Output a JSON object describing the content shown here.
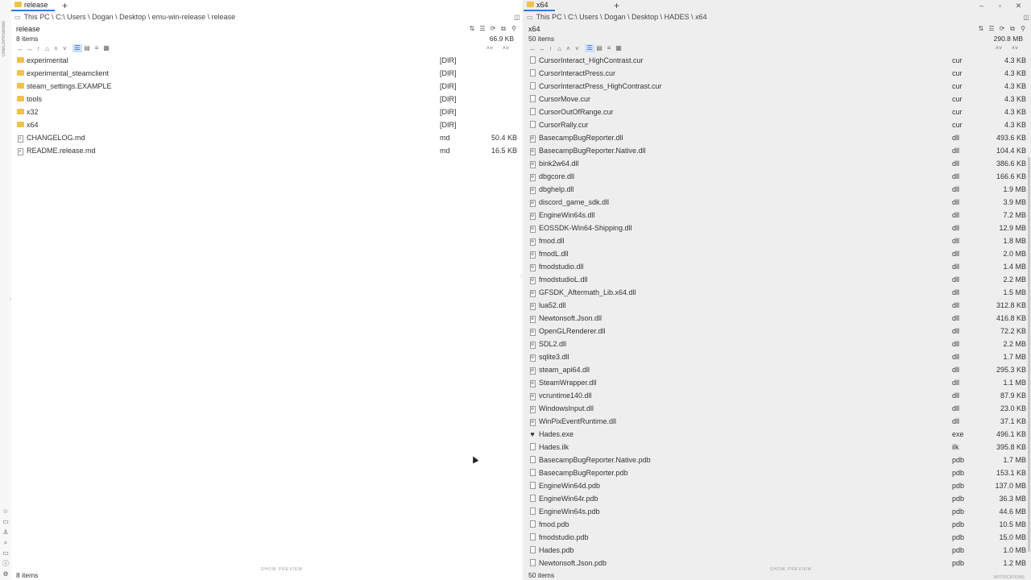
{
  "app": {
    "brand": "OneCommander"
  },
  "left": {
    "tab_label": "release",
    "new_tab": "+",
    "path": "This PC \\ C:\\ Users \\ Dogan \\ Desktop \\ emu-win-release \\ release",
    "folder_name": "release",
    "item_count": "8 items",
    "total_size": "66.9 KB",
    "status": "8 items",
    "preview_hint": "SHOW PREVIEW",
    "files": [
      {
        "name": "experimental",
        "ext": "[DIR]",
        "size": "",
        "kind": "folder"
      },
      {
        "name": "experimental_steamclient",
        "ext": "[DIR]",
        "size": "",
        "kind": "folder"
      },
      {
        "name": "steam_settings.EXAMPLE",
        "ext": "[DIR]",
        "size": "",
        "kind": "folder"
      },
      {
        "name": "tools",
        "ext": "[DIR]",
        "size": "",
        "kind": "folder"
      },
      {
        "name": "x32",
        "ext": "[DIR]",
        "size": "",
        "kind": "folder"
      },
      {
        "name": "x64",
        "ext": "[DIR]",
        "size": "",
        "kind": "folder"
      },
      {
        "name": "CHANGELOG.md",
        "ext": "md",
        "size": "50.4 KB",
        "kind": "md"
      },
      {
        "name": "README.release.md",
        "ext": "md",
        "size": "16.5 KB",
        "kind": "md"
      }
    ]
  },
  "right": {
    "tab_label": "x64",
    "new_tab": "+",
    "path": "This PC \\ C:\\ Users \\ Dogan \\ Desktop \\ HADES \\ x64",
    "folder_name": "x64",
    "item_count": "50 items",
    "total_size": "290.8 MB",
    "status": "50 items",
    "preview_hint": "SHOW PREVIEW",
    "notifications": "NOTIFICATIONS",
    "files": [
      {
        "name": "CursorInteract_HighContrast.cur",
        "ext": "cur",
        "size": "4.3 KB",
        "kind": "doc"
      },
      {
        "name": "CursorInteractPress.cur",
        "ext": "cur",
        "size": "4.3 KB",
        "kind": "doc"
      },
      {
        "name": "CursorInteractPress_HighContrast.cur",
        "ext": "cur",
        "size": "4.3 KB",
        "kind": "doc"
      },
      {
        "name": "CursorMove.cur",
        "ext": "cur",
        "size": "4.3 KB",
        "kind": "doc"
      },
      {
        "name": "CursorOutOfRange.cur",
        "ext": "cur",
        "size": "4.3 KB",
        "kind": "doc"
      },
      {
        "name": "CursorRally.cur",
        "ext": "cur",
        "size": "4.3 KB",
        "kind": "doc"
      },
      {
        "name": "BasecampBugReporter.dll",
        "ext": "dll",
        "size": "493.6 KB",
        "kind": "dll"
      },
      {
        "name": "BasecampBugReporter.Native.dll",
        "ext": "dll",
        "size": "104.4 KB",
        "kind": "dll"
      },
      {
        "name": "bink2w64.dll",
        "ext": "dll",
        "size": "386.6 KB",
        "kind": "dll"
      },
      {
        "name": "dbgcore.dll",
        "ext": "dll",
        "size": "166.6 KB",
        "kind": "dll"
      },
      {
        "name": "dbghelp.dll",
        "ext": "dll",
        "size": "1.9 MB",
        "kind": "dll"
      },
      {
        "name": "discord_game_sdk.dll",
        "ext": "dll",
        "size": "3.9 MB",
        "kind": "dll"
      },
      {
        "name": "EngineWin64s.dll",
        "ext": "dll",
        "size": "7.2 MB",
        "kind": "dll"
      },
      {
        "name": "EOSSDK-Win64-Shipping.dll",
        "ext": "dll",
        "size": "12.9 MB",
        "kind": "dll"
      },
      {
        "name": "fmod.dll",
        "ext": "dll",
        "size": "1.8 MB",
        "kind": "dll"
      },
      {
        "name": "fmodL.dll",
        "ext": "dll",
        "size": "2.0 MB",
        "kind": "dll"
      },
      {
        "name": "fmodstudio.dll",
        "ext": "dll",
        "size": "1.4 MB",
        "kind": "dll"
      },
      {
        "name": "fmodstudioL.dll",
        "ext": "dll",
        "size": "2.2 MB",
        "kind": "dll"
      },
      {
        "name": "GFSDK_Aftermath_Lib.x64.dll",
        "ext": "dll",
        "size": "1.5 MB",
        "kind": "dll"
      },
      {
        "name": "lua52.dll",
        "ext": "dll",
        "size": "312.8 KB",
        "kind": "dll"
      },
      {
        "name": "Newtonsoft.Json.dll",
        "ext": "dll",
        "size": "416.8 KB",
        "kind": "dll"
      },
      {
        "name": "OpenGLRenderer.dll",
        "ext": "dll",
        "size": "72.2 KB",
        "kind": "dll"
      },
      {
        "name": "SDL2.dll",
        "ext": "dll",
        "size": "2.2 MB",
        "kind": "dll"
      },
      {
        "name": "sqlite3.dll",
        "ext": "dll",
        "size": "1.7 MB",
        "kind": "dll"
      },
      {
        "name": "steam_api64.dll",
        "ext": "dll",
        "size": "295.3 KB",
        "kind": "dll"
      },
      {
        "name": "SteamWrapper.dll",
        "ext": "dll",
        "size": "1.1 MB",
        "kind": "dll"
      },
      {
        "name": "vcruntime140.dll",
        "ext": "dll",
        "size": "87.9 KB",
        "kind": "dll"
      },
      {
        "name": "WindowsInput.dll",
        "ext": "dll",
        "size": "23.0 KB",
        "kind": "dll"
      },
      {
        "name": "WinPixEventRuntime.dll",
        "ext": "dll",
        "size": "37.1 KB",
        "kind": "dll"
      },
      {
        "name": "Hades.exe",
        "ext": "exe",
        "size": "496.1 KB",
        "kind": "exe"
      },
      {
        "name": "Hades.ilk",
        "ext": "ilk",
        "size": "395.8 KB",
        "kind": "doc"
      },
      {
        "name": "BasecampBugReporter.Native.pdb",
        "ext": "pdb",
        "size": "1.7 MB",
        "kind": "doc"
      },
      {
        "name": "BasecampBugReporter.pdb",
        "ext": "pdb",
        "size": "153.1 KB",
        "kind": "doc"
      },
      {
        "name": "EngineWin64d.pdb",
        "ext": "pdb",
        "size": "137.0 MB",
        "kind": "doc"
      },
      {
        "name": "EngineWin64r.pdb",
        "ext": "pdb",
        "size": "36.3 MB",
        "kind": "doc"
      },
      {
        "name": "EngineWin64s.pdb",
        "ext": "pdb",
        "size": "44.6 MB",
        "kind": "doc"
      },
      {
        "name": "fmod.pdb",
        "ext": "pdb",
        "size": "10.5 MB",
        "kind": "doc"
      },
      {
        "name": "fmodstudio.pdb",
        "ext": "pdb",
        "size": "15.0 MB",
        "kind": "doc"
      },
      {
        "name": "Hades.pdb",
        "ext": "pdb",
        "size": "1.0 MB",
        "kind": "doc"
      },
      {
        "name": "Newtonsoft.Json.pdb",
        "ext": "pdb",
        "size": "1.2 MB",
        "kind": "doc"
      }
    ]
  },
  "window": {
    "minimize": "–",
    "maximize": "▫",
    "close": "✕"
  }
}
